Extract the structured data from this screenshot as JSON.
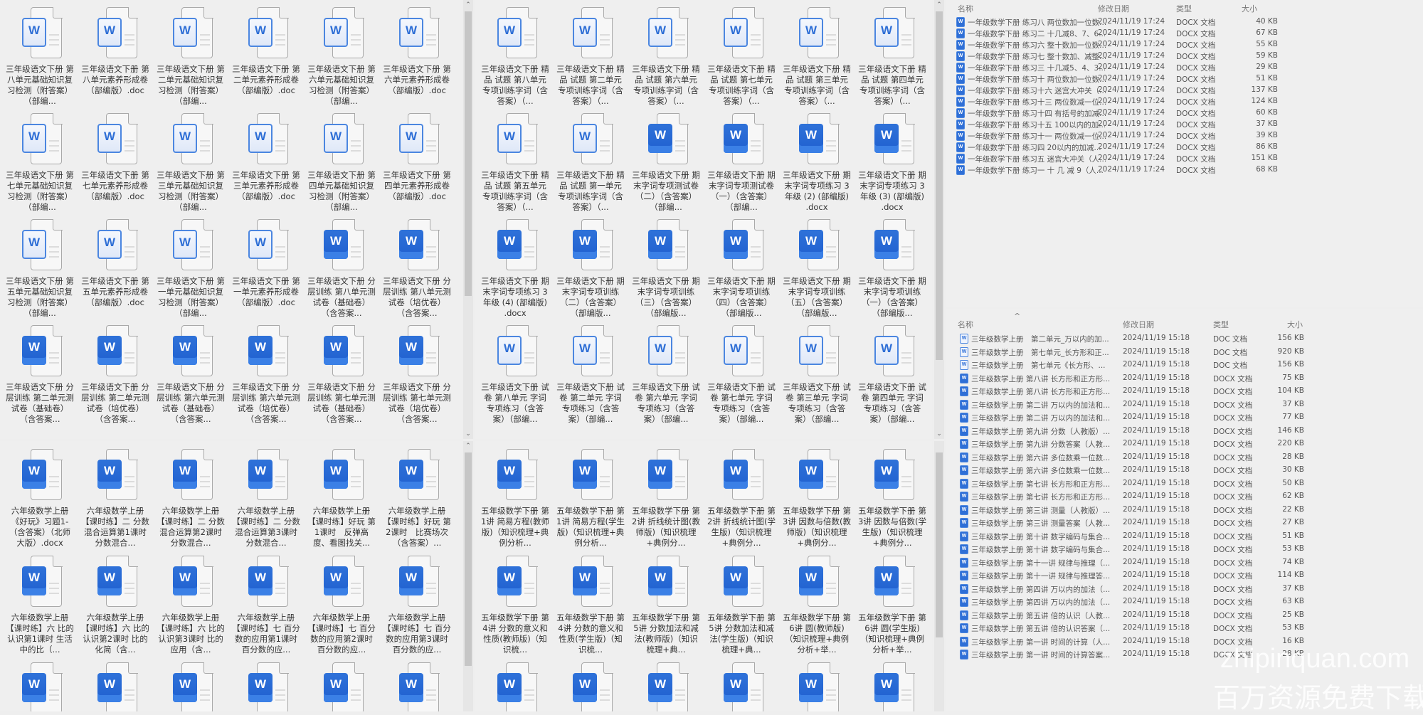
{
  "panels": [
    {
      "windows": [
        {
          "rows": [
            [
              {
                "label": "三年级语文下册 第八单元基础知识复习检测（附答案）（部编...",
                "style": "light"
              },
              {
                "label": "三年级语文下册 第八单元素养形成卷（部编版）.doc",
                "style": "light"
              },
              {
                "label": "三年级语文下册 第二单元基础知识复习检测（附答案）（部编...",
                "style": "light"
              },
              {
                "label": "三年级语文下册 第二单元素养形成卷（部编版）.doc",
                "style": "light"
              },
              {
                "label": "三年级语文下册 第六单元基础知识复习检测（附答案）（部编...",
                "style": "light"
              },
              {
                "label": "三年级语文下册 第六单元素养形成卷（部编版）.doc",
                "style": "light"
              }
            ],
            [
              {
                "label": "三年级语文下册 第七单元基础知识复习检测（附答案）（部编...",
                "style": "light"
              },
              {
                "label": "三年级语文下册 第七单元素养形成卷（部编版）.doc",
                "style": "light"
              },
              {
                "label": "三年级语文下册 第三单元基础知识复习检测（附答案）（部编...",
                "style": "light"
              },
              {
                "label": "三年级语文下册 第三单元素养形成卷（部编版）.doc",
                "style": "light"
              },
              {
                "label": "三年级语文下册 第四单元基础知识复习检测（附答案）（部编...",
                "style": "light"
              },
              {
                "label": "三年级语文下册 第四单元素养形成卷（部编版）.doc",
                "style": "light"
              }
            ],
            [
              {
                "label": "三年级语文下册 第五单元基础知识复习检测（附答案）（部编...",
                "style": "light"
              },
              {
                "label": "三年级语文下册 第五单元素养形成卷（部编版）.doc",
                "style": "light"
              },
              {
                "label": "三年级语文下册 第一单元基础知识复习检测（附答案）（部编...",
                "style": "light"
              },
              {
                "label": "三年级语文下册 第一单元素养形成卷（部编版）.doc",
                "style": "light"
              },
              {
                "label": "三年级语文下册 分层训练 第八单元测试卷（基础卷）（含答案...",
                "style": "solid"
              },
              {
                "label": "三年级语文下册 分层训练 第八单元测试卷（培优卷）（含答案...",
                "style": "solid"
              }
            ],
            [
              {
                "label": "三年级语文下册 分层训练 第二单元测试卷（基础卷）（含答案...",
                "style": "solid"
              },
              {
                "label": "三年级语文下册 分层训练 第二单元测试卷（培优卷）（含答案...",
                "style": "solid"
              },
              {
                "label": "三年级语文下册 分层训练 第六单元测试卷（基础卷）（含答案...",
                "style": "solid"
              },
              {
                "label": "三年级语文下册 分层训练 第六单元测试卷（培优卷）（含答案...",
                "style": "solid"
              },
              {
                "label": "三年级语文下册 分层训练 第七单元测试卷（基础卷）（含答案...",
                "style": "solid"
              },
              {
                "label": "三年级语文下册 分层训练 第七单元测试卷（培优卷）（含答案...",
                "style": "solid"
              }
            ]
          ]
        },
        {
          "rows": [
            [
              {
                "label": "六年级数学上册《好玩》习题1-（含答案）（北师大版）.docx",
                "style": "solid"
              },
              {
                "label": "六年级数学上册 【课时练】二 分数混合运算第1课时　分数混合...",
                "style": "solid"
              },
              {
                "label": "六年级数学上册 【课时练】二 分数混合运算第2课时　分数混合...",
                "style": "solid"
              },
              {
                "label": "六年级数学上册 【课时练】二 分数混合运算第3课时　分数混合...",
                "style": "solid"
              },
              {
                "label": "六年级数学上册 【课时练】好玩 第1课时　反弹高度、看图找关...",
                "style": "solid"
              },
              {
                "label": "六年级数学上册 【课时练】好玩 第2课时　比赛场次（含答案）...",
                "style": "solid"
              }
            ],
            [
              {
                "label": "六年级数学上册 【课时练】六 比的认识第1课时 生活中的比（...",
                "style": "solid"
              },
              {
                "label": "六年级数学上册 【课时练】六 比的认识第2课时 比的化简（含...",
                "style": "solid"
              },
              {
                "label": "六年级数学上册 【课时练】六 比的认识第3课时 比的应用（含...",
                "style": "solid"
              },
              {
                "label": "六年级数学上册 【课时练】七 百分数的应用第1课时　百分数的应...",
                "style": "solid"
              },
              {
                "label": "六年级数学上册 【课时练】七 百分数的应用第2课时　百分数的应...",
                "style": "solid"
              },
              {
                "label": "六年级数学上册 【课时练】七 百分数的应用第3课时　百分数的应...",
                "style": "solid"
              }
            ],
            [
              {
                "style": "solid"
              },
              {
                "style": "solid"
              },
              {
                "style": "solid"
              },
              {
                "style": "solid"
              },
              {
                "style": "solid"
              },
              {
                "style": "solid"
              }
            ]
          ]
        }
      ]
    },
    {
      "windows": [
        {
          "rows": [
            [
              {
                "label": "三年级语文下册 精品 试题 第八单元专项训练字词（含答案）（...",
                "style": "light"
              },
              {
                "label": "三年级语文下册 精品 试题 第二单元专项训练字词（含答案）（...",
                "style": "light"
              },
              {
                "label": "三年级语文下册 精品 试题 第六单元专项训练字词（含答案）（...",
                "style": "light"
              },
              {
                "label": "三年级语文下册 精品 试题 第七单元专项训练字词（含答案）（...",
                "style": "light"
              },
              {
                "label": "三年级语文下册 精品 试题 第三单元专项训练字词（含答案）（...",
                "style": "light"
              },
              {
                "label": "三年级语文下册 精品 试题 第四单元专项训练字词（含答案）（...",
                "style": "light"
              }
            ],
            [
              {
                "label": "三年级语文下册 精品 试题 第五单元专项训练字词（含答案）（...",
                "style": "light"
              },
              {
                "label": "三年级语文下册 精品 试题 第一单元专项训练字词（含答案）（...",
                "style": "light"
              },
              {
                "label": "三年级语文下册 期末字词专项测试卷（二）（含答案）（部编...",
                "style": "solid"
              },
              {
                "label": "三年级语文下册 期末字词专项测试卷（一）（含答案）（部编...",
                "style": "solid"
              },
              {
                "label": "三年级语文下册 期末字词专项练习 3年级 (2) (部编版) .docx",
                "style": "solid"
              },
              {
                "label": "三年级语文下册 期末字词专项练习 3年级 (3) (部编版) .docx",
                "style": "solid"
              }
            ],
            [
              {
                "label": "三年级语文下册 期末字词专项练习 3年级 (4) (部编版) .docx",
                "style": "solid"
              },
              {
                "label": "三年级语文下册 期末字词专项训练（二）（含答案）（部编版...",
                "style": "solid"
              },
              {
                "label": "三年级语文下册 期末字词专项训练（三）（含答案）（部编版...",
                "style": "solid"
              },
              {
                "label": "三年级语文下册 期末字词专项训练（四）（含答案）（部编版...",
                "style": "solid"
              },
              {
                "label": "三年级语文下册 期末字词专项训练（五）（含答案）（部编版...",
                "style": "solid"
              },
              {
                "label": "三年级语文下册 期末字词专项训练（一）（含答案）（部编版...",
                "style": "solid"
              }
            ],
            [
              {
                "label": "三年级语文下册 试卷 第八单元 字词专项练习（含答案）（部编...",
                "style": "light"
              },
              {
                "label": "三年级语文下册 试卷 第二单元 字词专项练习（含答案）（部编...",
                "style": "light"
              },
              {
                "label": "三年级语文下册 试卷 第六单元 字词专项练习（含答案）（部编...",
                "style": "light"
              },
              {
                "label": "三年级语文下册 试卷 第七单元 字词专项练习（含答案）（部编...",
                "style": "light"
              },
              {
                "label": "三年级语文下册 试卷 第三单元 字词专项练习（含答案）（部编...",
                "style": "light"
              },
              {
                "label": "三年级语文下册 试卷 第四单元 字词专项练习（含答案）（部编...",
                "style": "light"
              }
            ]
          ]
        },
        {
          "rows": [
            [
              {
                "label": "五年级数学下册 第1讲 简易方程(教师版)（知识梳理+典例分析...",
                "style": "solid"
              },
              {
                "label": "五年级数学下册 第1讲 简易方程(学生版)（知识梳理+典例分析...",
                "style": "solid"
              },
              {
                "label": "五年级数学下册 第2讲 折线统计图(教师版)（知识梳理+典例分...",
                "style": "solid"
              },
              {
                "label": "五年级数学下册 第2讲 折线统计图(学生版)（知识梳理+典例分...",
                "style": "solid"
              },
              {
                "label": "五年级数学下册 第3讲 因数与倍数(教师版)（知识梳理+典例分...",
                "style": "solid"
              },
              {
                "label": "五年级数学下册 第3讲 因数与倍数(学生版)（知识梳理+典例分...",
                "style": "solid"
              }
            ],
            [
              {
                "label": "五年级数学下册 第4讲 分数的意义和性质(教师版)（知识梳...",
                "style": "solid"
              },
              {
                "label": "五年级数学下册 第4讲 分数的意义和性质(学生版)（知识梳...",
                "style": "solid"
              },
              {
                "label": "五年级数学下册 第5讲 分数加法和减法(教师版)（知识梳理+典...",
                "style": "solid"
              },
              {
                "label": "五年级数学下册 第5讲 分数加法和减法(学生版)（知识梳理+典...",
                "style": "solid"
              },
              {
                "label": "五年级数学下册 第6讲 圆(教师版)（知识梳理+典例分析+举...",
                "style": "solid"
              },
              {
                "label": "五年级数学下册 第6讲 圆(学生版)（知识梳理+典例分析+举...",
                "style": "solid"
              }
            ],
            [
              {
                "style": "solid"
              },
              {
                "style": "solid"
              },
              {
                "style": "solid"
              },
              {
                "style": "solid"
              },
              {
                "style": "solid"
              },
              {
                "style": "solid"
              }
            ]
          ]
        }
      ]
    }
  ],
  "details_top": {
    "headers": {
      "name": "名称",
      "date": "修改日期",
      "type": "类型",
      "size": "大小"
    },
    "rows": [
      {
        "name": "一年级数学下册  练习八 两位数加一位数...",
        "date": "2024/11/19 17:24",
        "type": "DOCX 文档",
        "size": "40 KB"
      },
      {
        "name": "一年级数学下册  练习二 十几减8、7、6...",
        "date": "2024/11/19 17:24",
        "type": "DOCX 文档",
        "size": "67 KB"
      },
      {
        "name": "一年级数学下册  练习六 整十数加一位数...",
        "date": "2024/11/19 17:24",
        "type": "DOCX 文档",
        "size": "55 KB"
      },
      {
        "name": "一年级数学下册  练习七 整十数加、减整...",
        "date": "2024/11/19 17:24",
        "type": "DOCX 文档",
        "size": "59 KB"
      },
      {
        "name": "一年级数学下册  练习三 十几减5、4、3...",
        "date": "2024/11/19 17:24",
        "type": "DOCX 文档",
        "size": "29 KB"
      },
      {
        "name": "一年级数学下册  练习十 两位数加一位数...",
        "date": "2024/11/19 17:24",
        "type": "DOCX 文档",
        "size": "51 KB"
      },
      {
        "name": "一年级数学下册  练习十六 迷宫大冲关（...",
        "date": "2024/11/19 17:24",
        "type": "DOCX 文档",
        "size": "137 KB"
      },
      {
        "name": "一年级数学下册  练习十三 两位数减一位...",
        "date": "2024/11/19 17:24",
        "type": "DOCX 文档",
        "size": "124 KB"
      },
      {
        "name": "一年级数学下册  练习十四 有括号的加减...",
        "date": "2024/11/19 17:24",
        "type": "DOCX 文档",
        "size": "60 KB"
      },
      {
        "name": "一年级数学下册  练习十五 100以内的加...",
        "date": "2024/11/19 17:24",
        "type": "DOCX 文档",
        "size": "37 KB"
      },
      {
        "name": "一年级数学下册  练习十一 两位数减一位...",
        "date": "2024/11/19 17:24",
        "type": "DOCX 文档",
        "size": "39 KB"
      },
      {
        "name": "一年级数学下册  练习四 20以内的加减...",
        "date": "2024/11/19 17:24",
        "type": "DOCX 文档",
        "size": "86 KB"
      },
      {
        "name": "一年级数学下册  练习五 迷宫大冲关（人...",
        "date": "2024/11/19 17:24",
        "type": "DOCX 文档",
        "size": "151 KB"
      },
      {
        "name": "一年级数学下册  练习一 十 几 减 9（人...",
        "date": "2024/11/19 17:24",
        "type": "DOCX 文档",
        "size": "68 KB"
      }
    ]
  },
  "details_bottom": {
    "headers": {
      "name": "名称",
      "date": "修改日期",
      "type": "类型",
      "size": "大小"
    },
    "rows": [
      {
        "name": "三年级数学上册　第二单元_万以内的加...",
        "date": "2024/11/19 15:18",
        "type": "DOC 文档",
        "size": "156 KB"
      },
      {
        "name": "三年级数学上册　第七单元_长方形和正...",
        "date": "2024/11/19 15:18",
        "type": "DOC 文档",
        "size": "920 KB"
      },
      {
        "name": "三年级数学上册　第七单元《长方形、...",
        "date": "2024/11/19 15:18",
        "type": "DOC 文档",
        "size": "156 KB"
      },
      {
        "name": "三年级数学上册 第八讲 长方形和正方形...",
        "date": "2024/11/19 15:18",
        "type": "DOCX 文档",
        "size": "75 KB"
      },
      {
        "name": "三年级数学上册 第八讲 长方形和正方形...",
        "date": "2024/11/19 15:18",
        "type": "DOCX 文档",
        "size": "104 KB"
      },
      {
        "name": "三年级数学上册 第二讲 万以内的加法和...",
        "date": "2024/11/19 15:18",
        "type": "DOCX 文档",
        "size": "37 KB"
      },
      {
        "name": "三年级数学上册 第二讲 万以内的加法和...",
        "date": "2024/11/19 15:18",
        "type": "DOCX 文档",
        "size": "77 KB"
      },
      {
        "name": "三年级数学上册 第九讲 分数（人教版）...",
        "date": "2024/11/19 15:18",
        "type": "DOCX 文档",
        "size": "146 KB"
      },
      {
        "name": "三年级数学上册 第九讲 分数答案（人教...",
        "date": "2024/11/19 15:18",
        "type": "DOCX 文档",
        "size": "220 KB"
      },
      {
        "name": "三年级数学上册 第六讲 多位数乘一位数...",
        "date": "2024/11/19 15:18",
        "type": "DOCX 文档",
        "size": "28 KB"
      },
      {
        "name": "三年级数学上册 第六讲 多位数乘一位数...",
        "date": "2024/11/19 15:18",
        "type": "DOCX 文档",
        "size": "30 KB"
      },
      {
        "name": "三年级数学上册 第七讲 长方形和正方形...",
        "date": "2024/11/19 15:18",
        "type": "DOCX 文档",
        "size": "50 KB"
      },
      {
        "name": "三年级数学上册 第七讲 长方形和正方形...",
        "date": "2024/11/19 15:18",
        "type": "DOCX 文档",
        "size": "62 KB"
      },
      {
        "name": "三年级数学上册 第三讲 测量（人教版）...",
        "date": "2024/11/19 15:18",
        "type": "DOCX 文档",
        "size": "22 KB"
      },
      {
        "name": "三年级数学上册 第三讲 测量答案（人教...",
        "date": "2024/11/19 15:18",
        "type": "DOCX 文档",
        "size": "27 KB"
      },
      {
        "name": "三年级数学上册 第十讲 数字编码与集合...",
        "date": "2024/11/19 15:18",
        "type": "DOCX 文档",
        "size": "51 KB"
      },
      {
        "name": "三年级数学上册 第十讲 数字编码与集合...",
        "date": "2024/11/19 15:18",
        "type": "DOCX 文档",
        "size": "53 KB"
      },
      {
        "name": "三年级数学上册 第十一讲 规律与推理（...",
        "date": "2024/11/19 15:18",
        "type": "DOCX 文档",
        "size": "74 KB"
      },
      {
        "name": "三年级数学上册 第十一讲 规律与推理答...",
        "date": "2024/11/19 15:18",
        "type": "DOCX 文档",
        "size": "114 KB"
      },
      {
        "name": "三年级数学上册 第四讲 万以内的加法（...",
        "date": "2024/11/19 15:18",
        "type": "DOCX 文档",
        "size": "37 KB"
      },
      {
        "name": "三年级数学上册 第四讲 万以内的加法（...",
        "date": "2024/11/19 15:18",
        "type": "DOCX 文档",
        "size": "63 KB"
      },
      {
        "name": "三年级数学上册 第五讲 倍的认识（人教...",
        "date": "2024/11/19 15:18",
        "type": "DOCX 文档",
        "size": "25 KB"
      },
      {
        "name": "三年级数学上册 第五讲 倍的认识答案（...",
        "date": "2024/11/19 15:18",
        "type": "DOCX 文档",
        "size": "53 KB"
      },
      {
        "name": "三年级数学上册 第一讲 时间的计算（人...",
        "date": "2024/11/19 15:18",
        "type": "DOCX 文档",
        "size": "16 KB"
      },
      {
        "name": "三年级数学上册 第一讲 时间的计算答案...",
        "date": "2024/11/19 15:18",
        "type": "DOCX 文档",
        "size": "28 KB"
      }
    ]
  },
  "watermark": {
    "line1": "zhipinquan.com",
    "line2": "百万资源免费下载"
  },
  "icon_letter": "W"
}
